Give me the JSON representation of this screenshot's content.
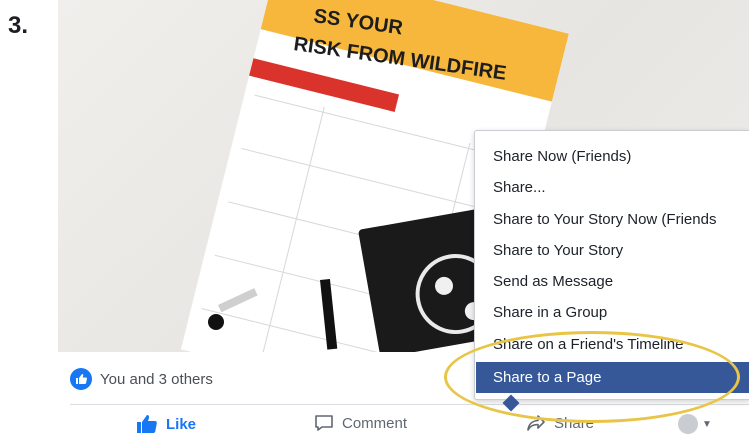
{
  "step_number": "3.",
  "photo": {
    "poster_title_line1": "SS YOUR",
    "poster_title_line2": "RISK FROM WILDFIRE"
  },
  "reactions": {
    "text": "You and 3 others"
  },
  "actions": {
    "like": "Like",
    "comment": "Comment",
    "share": "Share"
  },
  "share_menu": {
    "items": [
      "Share Now (Friends)",
      "Share...",
      "Share to Your Story Now (Friends",
      "Share to Your Story",
      "Send as Message",
      "Share in a Group",
      "Share on a Friend's Timeline",
      "Share to a Page"
    ],
    "selected_index": 7
  },
  "colors": {
    "facebook_blue": "#1877f2",
    "menu_highlight": "#365899",
    "annotation_ellipse": "#e8c547"
  }
}
